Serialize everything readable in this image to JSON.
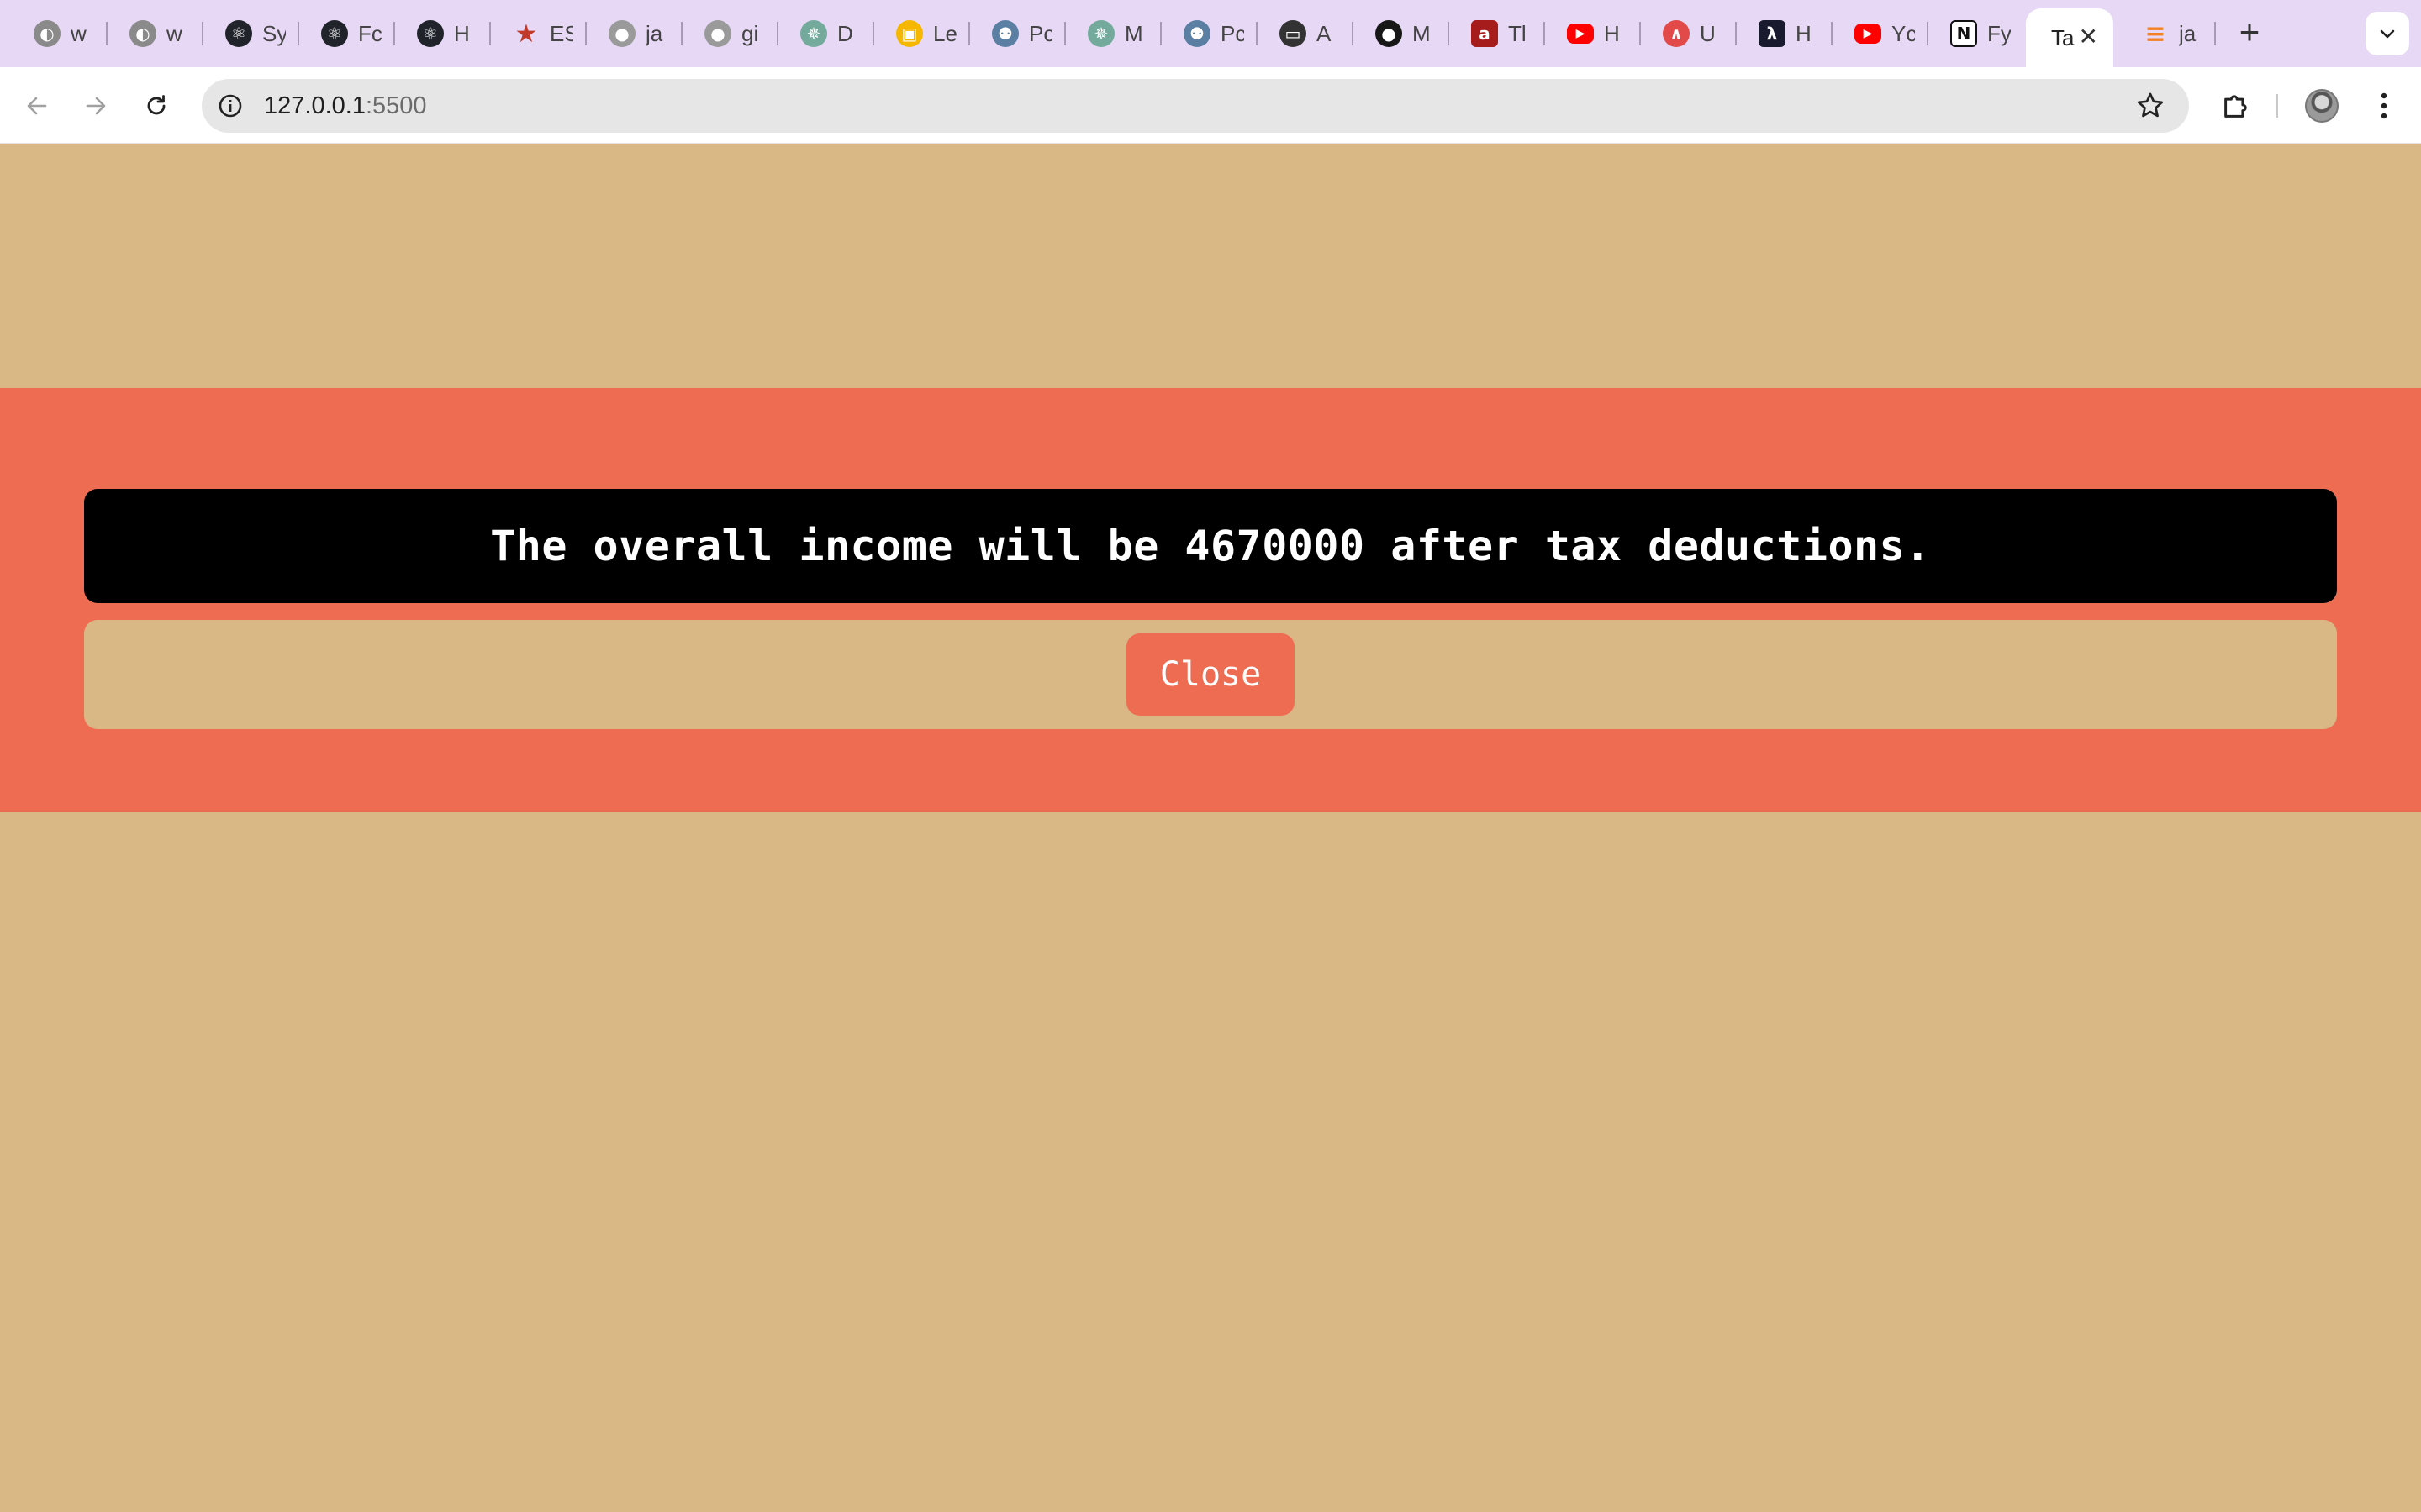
{
  "browser": {
    "tabs": [
      {
        "label": "w",
        "icon": "privacy-shield-icon",
        "color": "#8a8a8a"
      },
      {
        "label": "w",
        "icon": "privacy-shield-icon",
        "color": "#8a8a8a"
      },
      {
        "label": "Sy",
        "icon": "react-icon",
        "color": "#20232a"
      },
      {
        "label": "Fc",
        "icon": "react-icon",
        "color": "#20232a"
      },
      {
        "label": "H",
        "icon": "react-icon",
        "color": "#20232a"
      },
      {
        "label": "ES",
        "icon": "star-icon",
        "color": "#c0392b"
      },
      {
        "label": "ja",
        "icon": "github-icon",
        "color": "#9a9a9a"
      },
      {
        "label": "gi",
        "icon": "github-icon",
        "color": "#9a9a9a"
      },
      {
        "label": "D",
        "icon": "chatgpt-icon",
        "color": "#74aa9c"
      },
      {
        "label": "Le",
        "icon": "leetcode-icon",
        "color": "#f5b700"
      },
      {
        "label": "Pc",
        "icon": "postgres-icon",
        "color": "#5a7fa3"
      },
      {
        "label": "M",
        "icon": "chatgpt-icon",
        "color": "#74aa9c"
      },
      {
        "label": "Pc",
        "icon": "postgres-icon",
        "color": "#5a7fa3"
      },
      {
        "label": "A",
        "icon": "document-icon",
        "color": "#333333"
      },
      {
        "label": "M",
        "icon": "github-icon",
        "color": "#181717"
      },
      {
        "label": "Tl",
        "icon": "a-letter-icon",
        "color": "#a61c1c"
      },
      {
        "label": "H",
        "icon": "youtube-icon",
        "color": "#ff0000"
      },
      {
        "label": "U",
        "icon": "udemy-icon",
        "color": "#e24a4a"
      },
      {
        "label": "H",
        "icon": "lambda-icon",
        "color": "#1a1a2e"
      },
      {
        "label": "Yc",
        "icon": "youtube-icon",
        "color": "#ff0000"
      },
      {
        "label": "Fy",
        "icon": "notion-icon",
        "color": "#111111"
      },
      {
        "label": "Ta",
        "icon": "page-icon",
        "color": "#ffffff"
      },
      {
        "label": "ja",
        "icon": "stackoverflow-icon",
        "color": "#f48024"
      }
    ],
    "active_tab_index": 21,
    "address": {
      "host": "127.0.0.1",
      "port": ":5500"
    }
  },
  "modal": {
    "message": "The overall income will be 4670000 after tax deductions.",
    "close_label": "Close"
  },
  "colors": {
    "page_background": "#d9b886",
    "modal_background": "#ee6c52",
    "message_background": "#000000",
    "button_background": "#ee6c52",
    "tabstrip": "#e7d8f6"
  }
}
